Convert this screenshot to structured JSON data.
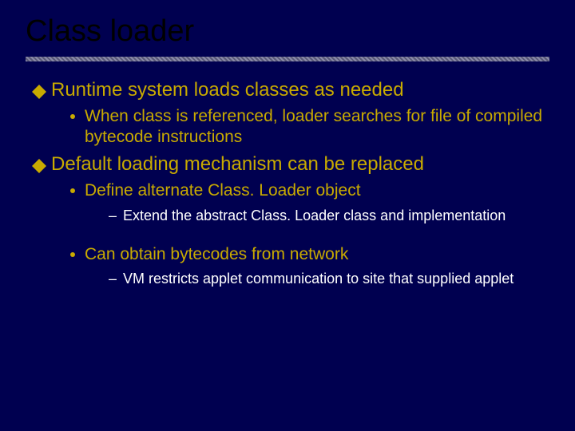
{
  "title": "Class loader",
  "bullets": {
    "p1": "Runtime system loads classes as needed",
    "p1_a": "When class is referenced, loader searches for file of compiled bytecode instructions",
    "p2": "Default loading mechanism can be replaced",
    "p2_a": "Define alternate Class. Loader object",
    "p2_a_i": "Extend the abstract Class. Loader class and implementation",
    "p2_b": "Can obtain bytecodes from network",
    "p2_b_i": "VM restricts applet communication to site that supplied applet"
  },
  "glyphs": {
    "dash": "–"
  }
}
